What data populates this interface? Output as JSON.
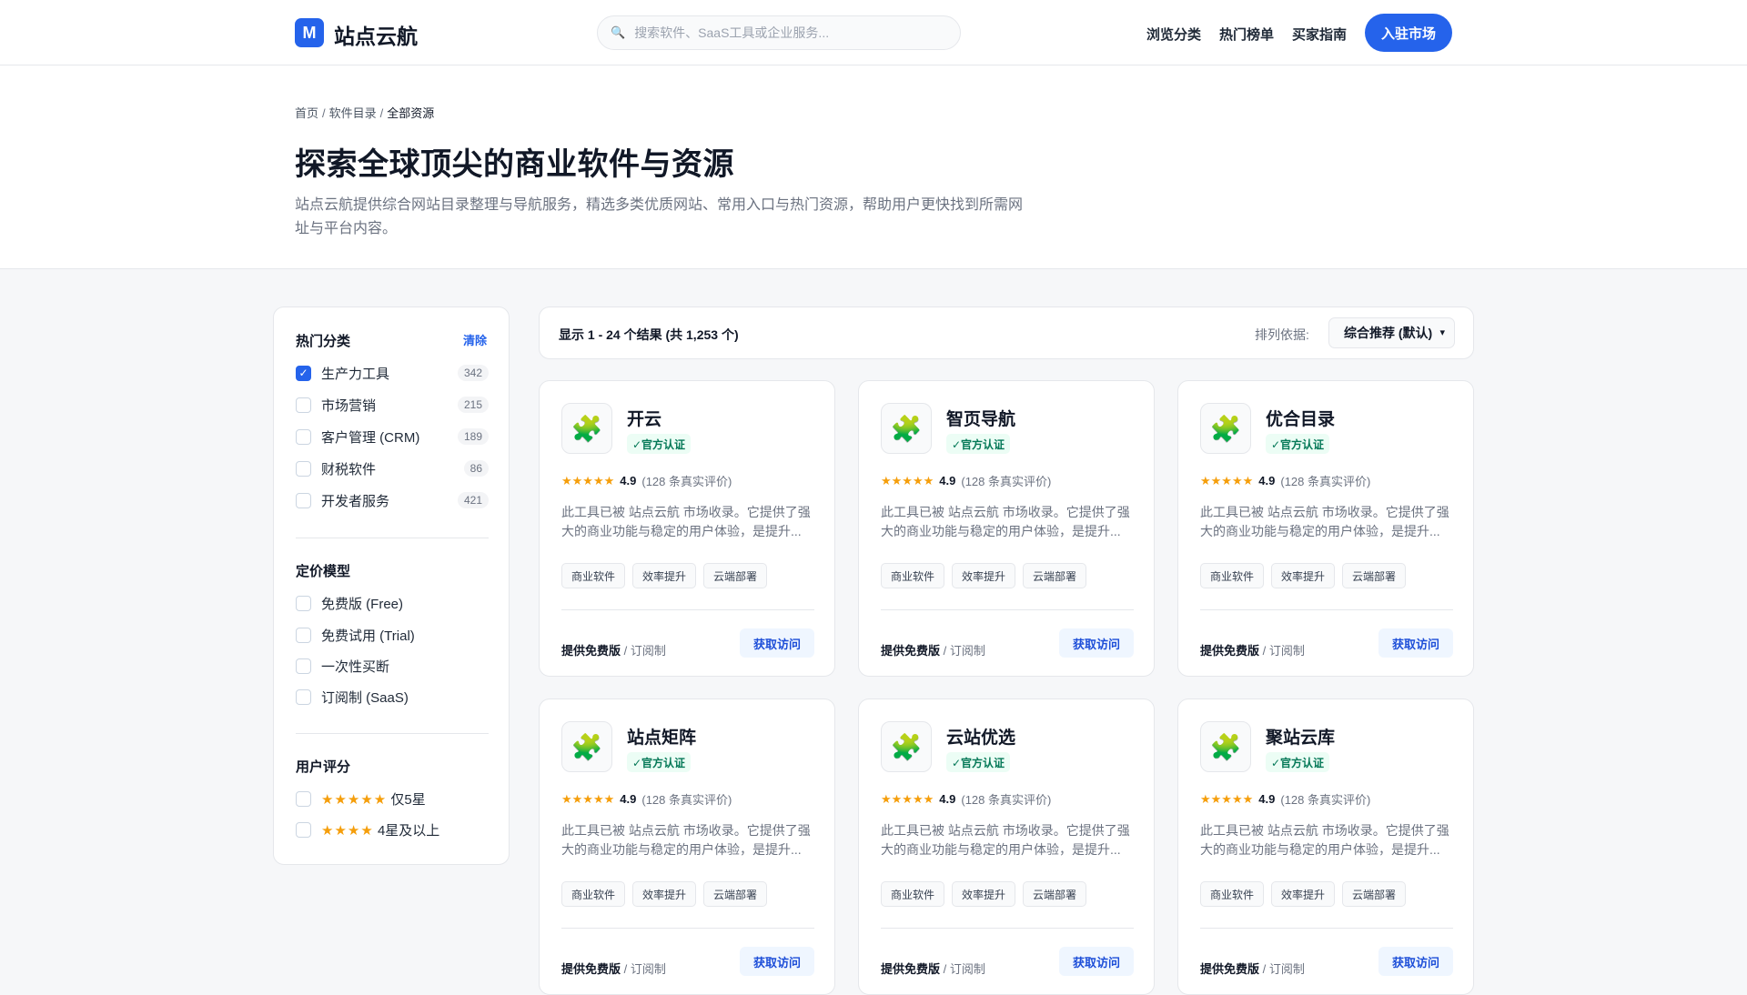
{
  "header": {
    "logo_letter": "M",
    "brand": "站点云航",
    "search_placeholder": "搜索软件、SaaS工具或企业服务...",
    "nav": [
      "浏览分类",
      "热门榜单",
      "买家指南"
    ],
    "cta": "入驻市场"
  },
  "hero": {
    "breadcrumb": [
      "首页",
      "软件目录",
      "全部资源"
    ],
    "title": "探索全球顶尖的商业软件与资源",
    "description": "站点云航提供综合网站目录整理与导航服务，精选多类优质网站、常用入口与热门资源，帮助用户更快找到所需网址与平台内容。"
  },
  "sidebar": {
    "categories_title": "热门分类",
    "clear": "清除",
    "categories": [
      {
        "label": "生产力工具",
        "count": "342",
        "checked": true
      },
      {
        "label": "市场营销",
        "count": "215",
        "checked": false
      },
      {
        "label": "客户管理 (CRM)",
        "count": "189",
        "checked": false
      },
      {
        "label": "财税软件",
        "count": "86",
        "checked": false
      },
      {
        "label": "开发者服务",
        "count": "421",
        "checked": false
      }
    ],
    "pricing_title": "定价模型",
    "pricing": [
      "免费版 (Free)",
      "免费试用 (Trial)",
      "一次性买断",
      "订阅制 (SaaS)"
    ],
    "rating_title": "用户评分",
    "ratings": [
      {
        "stars": "★★★★★",
        "label": "仅5星"
      },
      {
        "stars": "★★★★",
        "label": "4星及以上"
      }
    ]
  },
  "results": {
    "summary": "显示 1 - 24 个结果 (共 1,253 个)",
    "sort_label": "排列依据:",
    "sort_value": "综合推荐 (默认)"
  },
  "card_common": {
    "icon": "puzzle-icon",
    "badge": "✓官方认证",
    "stars": "★★★★★",
    "rating": "4.9",
    "reviews": "(128 条真实评价)",
    "description": "此工具已被 站点云航 市场收录。它提供了强大的商业功能与稳定的用户体验，是提升...",
    "tags": [
      "商业软件",
      "效率提升",
      "云端部署"
    ],
    "price_strong": "提供免费版",
    "price_rest": " / 订阅制",
    "button": "获取访问"
  },
  "cards": [
    {
      "name": "开云"
    },
    {
      "name": "智页导航"
    },
    {
      "name": "优合目录"
    },
    {
      "name": "站点矩阵"
    },
    {
      "name": "云站优选"
    },
    {
      "name": "聚站云库"
    }
  ],
  "colors": {
    "accent": "#2563eb",
    "badge_bg": "#ecfdf5",
    "badge_text": "#047857",
    "star": "#f59e0b"
  }
}
